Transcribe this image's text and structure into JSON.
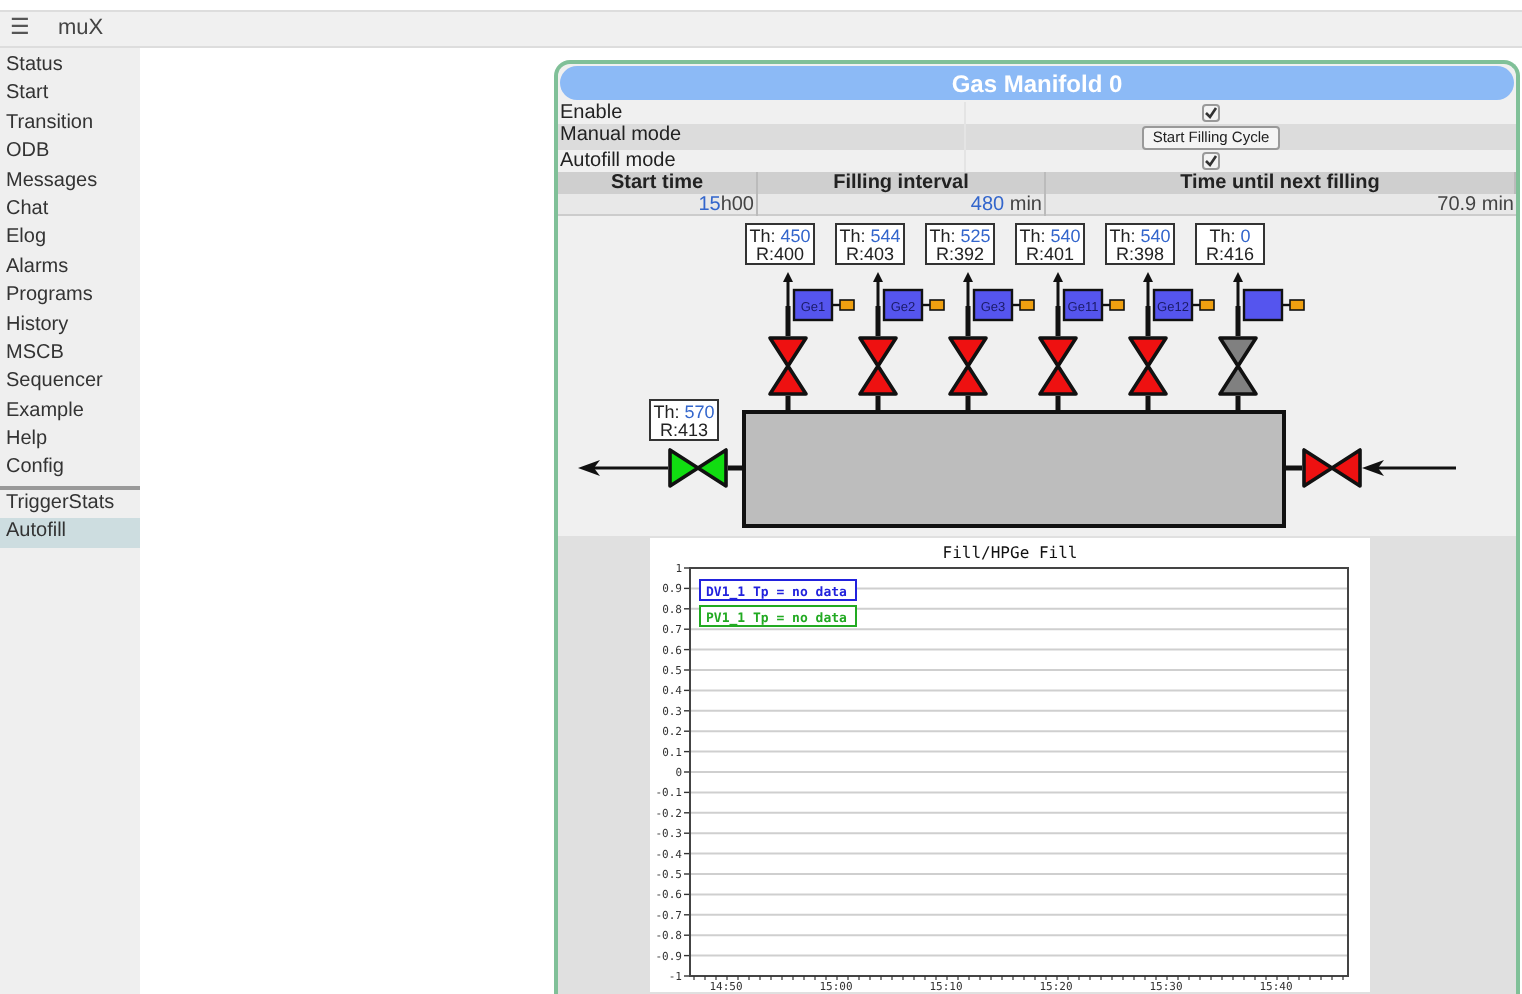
{
  "header": {
    "menu_icon": "☰",
    "title": "muX"
  },
  "sidebar": {
    "items": [
      {
        "label": "Status",
        "selected": false
      },
      {
        "label": "Start",
        "selected": false
      },
      {
        "label": "Transition",
        "selected": false
      },
      {
        "label": "ODB",
        "selected": false
      },
      {
        "label": "Messages",
        "selected": false
      },
      {
        "label": "Chat",
        "selected": false
      },
      {
        "label": "Elog",
        "selected": false
      },
      {
        "label": "Alarms",
        "selected": false
      },
      {
        "label": "Programs",
        "selected": false
      },
      {
        "label": "History",
        "selected": false
      },
      {
        "label": "MSCB",
        "selected": false
      },
      {
        "label": "Sequencer",
        "selected": false
      },
      {
        "label": "Example",
        "selected": false
      },
      {
        "label": "Help",
        "selected": false
      },
      {
        "label": "Config",
        "selected": false
      }
    ],
    "custom_items": [
      {
        "label": "TriggerStats",
        "selected": false
      },
      {
        "label": "Autofill",
        "selected": true
      }
    ]
  },
  "panel": {
    "title": "Gas Manifold 0",
    "settings": [
      {
        "kind": "checkbox",
        "label": "Enable",
        "checked": true
      },
      {
        "kind": "button",
        "label": "Manual mode",
        "button": "Start Filling Cycle"
      },
      {
        "kind": "checkbox",
        "label": "Autofill mode",
        "checked": true
      }
    ],
    "schedule": {
      "columns": [
        "Start time",
        "Filling interval",
        "Time until next filling"
      ],
      "start_time": {
        "value": "15",
        "unit": "h00"
      },
      "interval": {
        "value": "480",
        "unit": "min"
      },
      "time_until_next": "70.9 min"
    },
    "manifold": {
      "detectors": [
        {
          "label": "Ge1",
          "th_label": "Th:",
          "th": "450",
          "reading": "R:400",
          "color": "#ee1111"
        },
        {
          "label": "Ge2",
          "th_label": "Th:",
          "th": "544",
          "reading": "R:403",
          "color": "#ee1111"
        },
        {
          "label": "Ge3",
          "th_label": "Th:",
          "th": "525",
          "reading": "R:392",
          "color": "#ee1111"
        },
        {
          "label": "Ge11",
          "th_label": "Th:",
          "th": "540",
          "reading": "R:401",
          "color": "#ee1111"
        },
        {
          "label": "Ge12",
          "th_label": "Th:",
          "th": "540",
          "reading": "R:398",
          "color": "#ee1111"
        },
        {
          "th_label": "Th:",
          "th": "0",
          "reading": "R:416",
          "color": "#808080"
        }
      ],
      "line_valves": [
        {
          "kind": "outlet",
          "th_label": "Th:",
          "th": "570",
          "reading": "R:413",
          "color": "#11dd11"
        },
        {
          "kind": "inlet",
          "color": "#ee1111"
        }
      ]
    },
    "chart_data": {
      "type": "line",
      "title": "Fill/HPGe Fill",
      "series": [
        {
          "name": "DV1_1 Tp = no data",
          "color": "#2222dd",
          "values": [
            null,
            null,
            null,
            null,
            null,
            null
          ]
        },
        {
          "name": "PV1_1 Tp = no data",
          "color": "#22aa22",
          "values": [
            null,
            null,
            null,
            null,
            null,
            null
          ]
        }
      ],
      "ylim": [
        -1,
        1
      ],
      "yticks": [
        1,
        0.9,
        0.8,
        0.7,
        0.6,
        0.5,
        0.4,
        0.3,
        0.2,
        0.1,
        0,
        -0.1,
        -0.2,
        -0.3,
        -0.4,
        -0.5,
        -0.6,
        -0.7,
        -0.8,
        -0.9,
        -1
      ],
      "categories": [
        "14:50",
        "15:00",
        "15:10",
        "15:20",
        "15:30",
        "15:40"
      ],
      "grid": true
    }
  }
}
